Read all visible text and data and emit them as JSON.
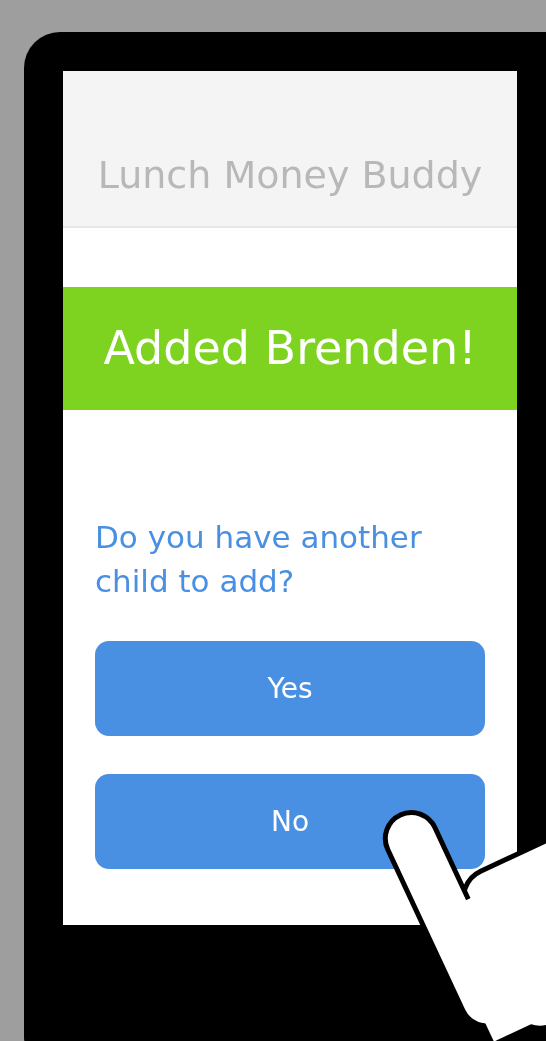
{
  "app_title": "Lunch Money Buddy",
  "banner": "Added Brenden!",
  "question": "Do you have another child to add?",
  "buttons": [
    {
      "label": "Yes"
    },
    {
      "label": "No"
    }
  ]
}
